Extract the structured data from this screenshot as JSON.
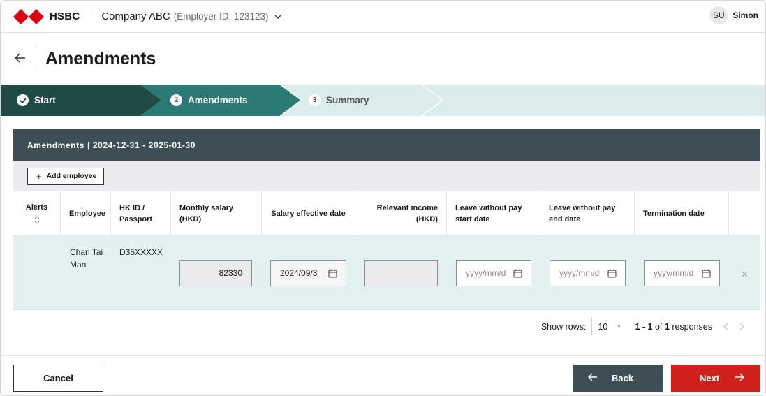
{
  "brand": {
    "name": "HSBC",
    "logo": "hsbc-hexagon-logo",
    "brand_color": "#db0011"
  },
  "header": {
    "company": "Company ABC",
    "employer_id": "(Employer ID: 123123)",
    "chevron_icon": "chevron-down-icon",
    "user_initials": "SU",
    "user_name": "Simon"
  },
  "page": {
    "back_icon": "arrow-left-icon",
    "title": "Amendments"
  },
  "stepper": {
    "steps": [
      {
        "label": "Start",
        "state": "done",
        "marker_icon": "check-icon"
      },
      {
        "label": "Amendments",
        "state": "current",
        "number": "2"
      },
      {
        "label": "Summary",
        "state": "upcoming",
        "number": "3"
      }
    ],
    "colors": {
      "done": "#1f4a46",
      "current": "#2c7a74",
      "upcoming": "#dcecec"
    }
  },
  "table": {
    "heading": "Amendments | 2024-12-31 - 2025-01-30",
    "add_button": "Add employee",
    "columns": [
      "Alerts",
      "Employee",
      "HK ID / Passport",
      "Monthly salary (HKD)",
      "Salary effective date",
      "Relevant income (HKD)",
      "Leave without pay start date",
      "Leave without pay end date",
      "Termination date"
    ],
    "rows": [
      {
        "alerts": "",
        "employee": "Chan Tai Man",
        "hkid": "D35XXXXX",
        "monthly_salary": "82330",
        "salary_effective_date": "2024/09/3",
        "relevant_income": "",
        "lwop_start": "",
        "lwop_end": "",
        "termination_date": ""
      }
    ],
    "date_placeholder": "yyyy/mm/d",
    "remove_icon": "close-icon"
  },
  "pagination": {
    "show_rows_label": "Show rows:",
    "rows_per_page": "10",
    "range": "1 - 1",
    "of_word": "of",
    "total": "1",
    "suffix": "responses"
  },
  "footer": {
    "cancel": "Cancel",
    "back": "Back",
    "next": "Next",
    "next_color": "#d0201b"
  }
}
